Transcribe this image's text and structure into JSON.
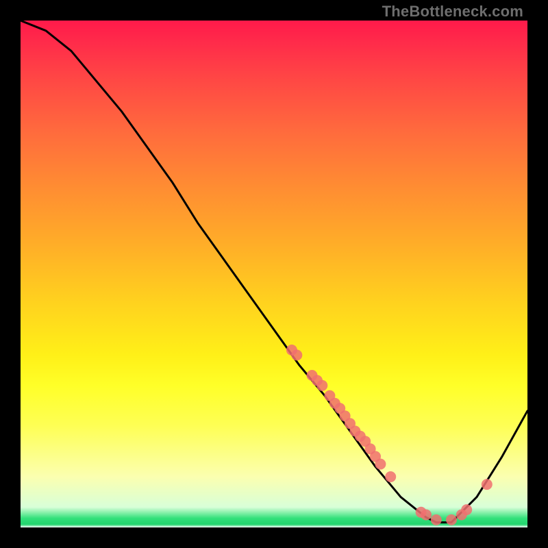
{
  "watermark": "TheBottleneck.com",
  "chart_data": {
    "type": "line",
    "title": "",
    "xlabel": "",
    "ylabel": "",
    "xlim": [
      0,
      100
    ],
    "ylim": [
      0,
      100
    ],
    "grid": false,
    "series": [
      {
        "name": "curve",
        "x": [
          0,
          5,
          10,
          15,
          20,
          25,
          30,
          35,
          40,
          45,
          50,
          55,
          60,
          65,
          70,
          75,
          80,
          82,
          85,
          90,
          95,
          100
        ],
        "y": [
          100,
          98,
          94,
          88,
          82,
          75,
          68,
          60,
          53,
          46,
          39,
          32,
          26,
          19,
          12,
          6,
          2,
          1,
          1,
          6,
          14,
          23
        ]
      },
      {
        "name": "markers",
        "x": [
          53.5,
          54.5,
          57.5,
          58.5,
          59.5,
          61.0,
          62.0,
          63.0,
          64.0,
          65.0,
          66.0,
          67.0,
          68.0,
          69.0,
          70.0,
          71.0,
          73.0,
          79.0,
          80.0,
          82.0,
          85.0,
          87.0,
          88.0,
          92.0
        ],
        "y": [
          35,
          34,
          30,
          29,
          28,
          26,
          24.5,
          23.5,
          22,
          20.5,
          19,
          18,
          17,
          15.5,
          14,
          12.5,
          10,
          3,
          2.5,
          1.5,
          1.5,
          2.5,
          3.5,
          8.5
        ]
      }
    ],
    "marker_color": "#f07070",
    "line_color": "#000000"
  }
}
